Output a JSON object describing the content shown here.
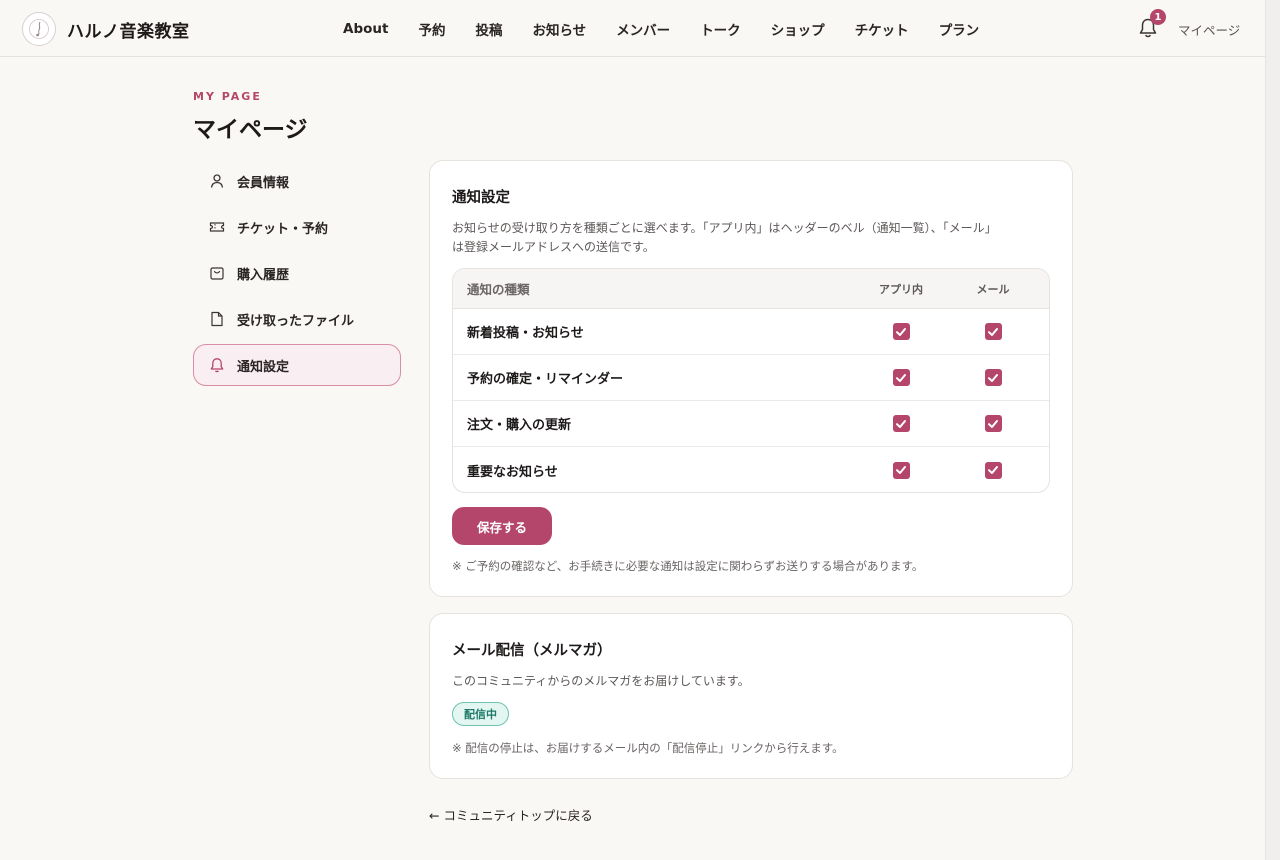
{
  "header": {
    "logo_icon": "music-note-icon",
    "brand": "ハルノ音楽教室",
    "nav": [
      "About",
      "予約",
      "投稿",
      "お知らせ",
      "メンバー",
      "トーク",
      "ショップ",
      "チケット",
      "プラン"
    ],
    "bell_badge": "1",
    "mypage": "マイページ"
  },
  "page": {
    "eyebrow": "MY PAGE",
    "title": "マイページ"
  },
  "sidebar": {
    "items": [
      {
        "label": "会員情報",
        "icon": "user-icon",
        "active": false
      },
      {
        "label": "チケット・予約",
        "icon": "ticket-icon",
        "active": false
      },
      {
        "label": "購入履歴",
        "icon": "shopping-bag-icon",
        "active": false
      },
      {
        "label": "受け取ったファイル",
        "icon": "file-icon",
        "active": false
      },
      {
        "label": "通知設定",
        "icon": "bell-icon",
        "active": true
      }
    ]
  },
  "notify": {
    "title": "通知設定",
    "desc_line1": "お知らせの受け取り方を種類ごとに選べます。「アプリ内」はヘッダーのベル（通知一覧）、「メール」",
    "desc_line2": "は登録メールアドレスへの送信です。",
    "col_type": "通知の種類",
    "col_app": "アプリ内",
    "col_mail": "メール",
    "rows": [
      {
        "label": "新着投稿・お知らせ",
        "app": true,
        "mail": true
      },
      {
        "label": "予約の確定・リマインダー",
        "app": true,
        "mail": true
      },
      {
        "label": "注文・購入の更新",
        "app": true,
        "mail": true
      },
      {
        "label": "重要なお知らせ",
        "app": true,
        "mail": true
      }
    ],
    "save": "保存する",
    "note": "※ ご予約の確認など、お手続きに必要な通知は設定に関わらずお送りする場合があります。"
  },
  "mail": {
    "title": "メール配信（メルマガ）",
    "desc": "このコミュニティからのメルマガをお届けしています。",
    "status": "配信中",
    "note": "※ 配信の停止は、お届けするメール内の「配信停止」リンクから行えます。"
  },
  "back": "← コミュニティトップに戻る",
  "colors": {
    "accent": "#b5466b",
    "status_bg": "#e3f6f2",
    "status_text": "#1e7a68"
  }
}
